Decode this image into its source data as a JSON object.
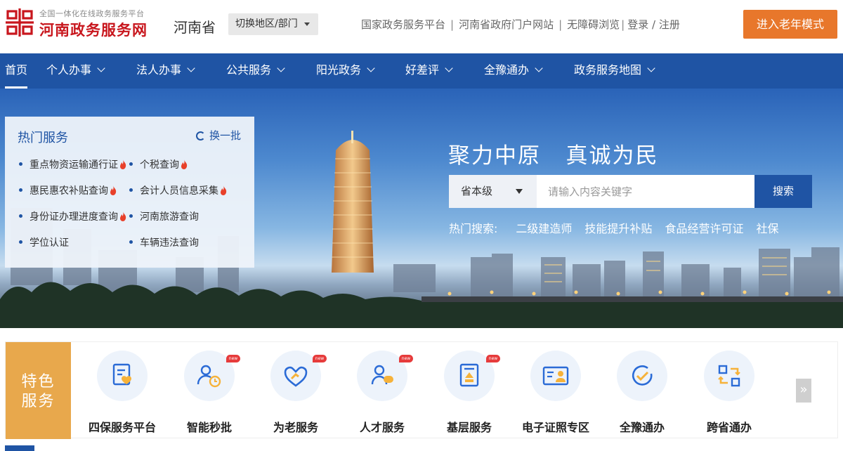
{
  "header": {
    "logo_subtitle": "全国一体化在线政务服务平台",
    "logo_title": "河南政务服务网",
    "province": "河南省",
    "switch_label": "切换地区/部门",
    "links": [
      "国家政务服务平台",
      "河南省政府门户网站",
      "无障碍浏览",
      "登录 / 注册"
    ],
    "elder_mode": "进入老年模式"
  },
  "nav": {
    "items": [
      {
        "label": "首页",
        "dropdown": false,
        "active": true
      },
      {
        "label": "个人办事",
        "dropdown": true
      },
      {
        "label": "法人办事",
        "dropdown": true
      },
      {
        "label": "公共服务",
        "dropdown": true
      },
      {
        "label": "阳光政务",
        "dropdown": true
      },
      {
        "label": "好差评",
        "dropdown": true
      },
      {
        "label": "全豫通办",
        "dropdown": true
      },
      {
        "label": "政务服务地图",
        "dropdown": true
      }
    ]
  },
  "hot_services": {
    "title": "热门服务",
    "refresh": "换一批",
    "items": [
      {
        "label": "重点物资运输通行证",
        "hot": true
      },
      {
        "label": "个税查询",
        "hot": true
      },
      {
        "label": "惠民惠农补贴查询",
        "hot": true
      },
      {
        "label": "会计人员信息采集",
        "hot": true
      },
      {
        "label": "身份证办理进度查询",
        "hot": true
      },
      {
        "label": "河南旅游查询",
        "hot": false
      },
      {
        "label": "学位认证",
        "hot": false
      },
      {
        "label": "车辆违法查询",
        "hot": false
      }
    ]
  },
  "banner": {
    "slogan": "聚力中原   真诚为民",
    "search": {
      "scope": "省本级",
      "placeholder": "请输入内容关键字",
      "button": "搜索"
    },
    "hot_search_label": "热门搜索:",
    "hot_searches": [
      "二级建造师",
      "技能提升补贴",
      "食品经营许可证",
      "社保"
    ]
  },
  "featured": {
    "label_line1": "特色",
    "label_line2": "服务",
    "items": [
      {
        "label": "四保服务平台",
        "icon": "document-heart-icon",
        "new": false
      },
      {
        "label": "智能秒批",
        "icon": "user-clock-icon",
        "new": true
      },
      {
        "label": "为老服务",
        "icon": "heart-hand-icon",
        "new": true
      },
      {
        "label": "人才服务",
        "icon": "users-icon",
        "new": true
      },
      {
        "label": "基层服务",
        "icon": "building-doc-icon",
        "new": true
      },
      {
        "label": "电子证照专区",
        "icon": "id-card-icon",
        "new": false
      },
      {
        "label": "全豫通办",
        "icon": "check-circle-icon",
        "new": false
      },
      {
        "label": "跨省通办",
        "icon": "transfer-icon",
        "new": false
      }
    ],
    "new_badge": "new",
    "more": "»"
  },
  "colors": {
    "primary": "#1f54a4",
    "brand_red": "#c8161d",
    "elder_orange": "#e8772b",
    "feature_gold": "#e8a84c",
    "fire": "#e8402a"
  }
}
